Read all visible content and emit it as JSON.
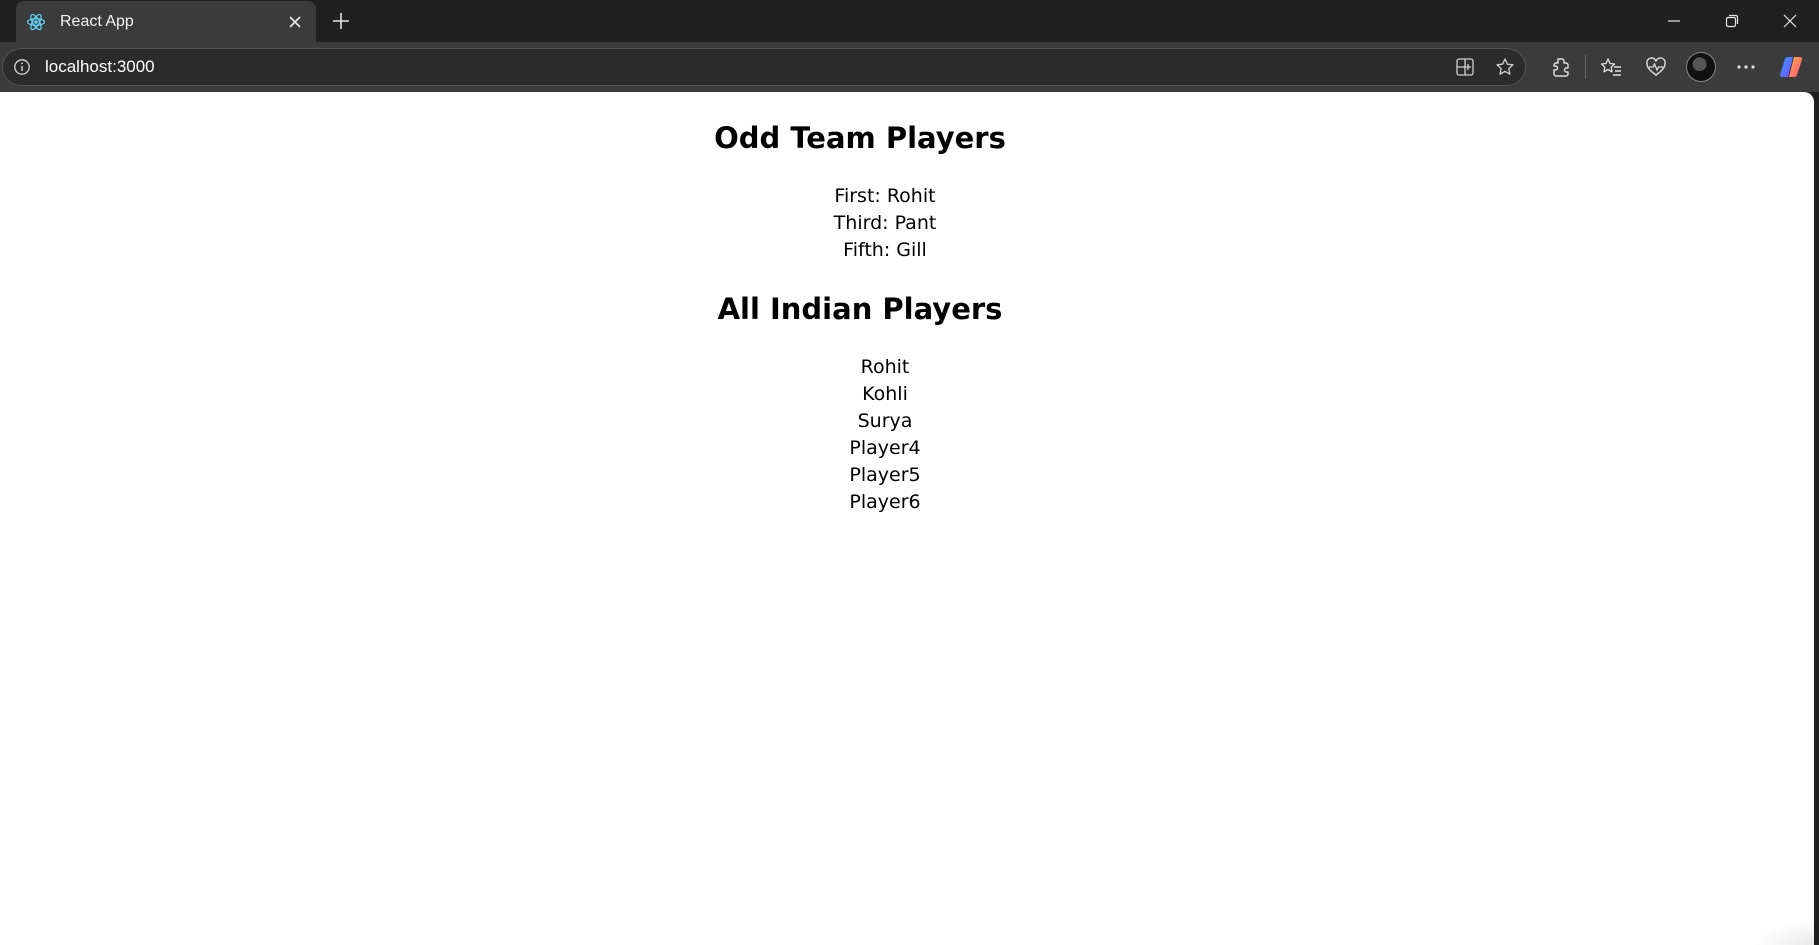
{
  "browser": {
    "tab": {
      "title": "React App",
      "favicon": "react-icon",
      "close_icon": "close-icon"
    },
    "new_tab_icon": "plus-icon",
    "window_controls": [
      "minimize-icon",
      "restore-icon",
      "close-icon"
    ],
    "address_bar": {
      "url": "localhost:3000",
      "site_info_icon": "info-icon",
      "actions": [
        "split-screen-icon",
        "favorite-star-icon"
      ]
    },
    "toolbar_icons": [
      "extensions-icon",
      "favorites-icon",
      "browser-essentials-icon",
      "profile-avatar",
      "more-icon",
      "copilot-icon"
    ]
  },
  "page": {
    "odd_heading": "Odd Team Players",
    "odd_players": [
      "First: Rohit",
      "Third: Pant",
      "Fifth: Gill"
    ],
    "all_heading": "All Indian Players",
    "all_players": [
      "Rohit",
      "Kohli",
      "Surya",
      "Player4",
      "Player5",
      "Player6"
    ]
  },
  "colors": {
    "chrome_dark": "#202020",
    "toolbar": "#3b3b3b",
    "page_bg": "#ffffff",
    "text": "#000000"
  }
}
